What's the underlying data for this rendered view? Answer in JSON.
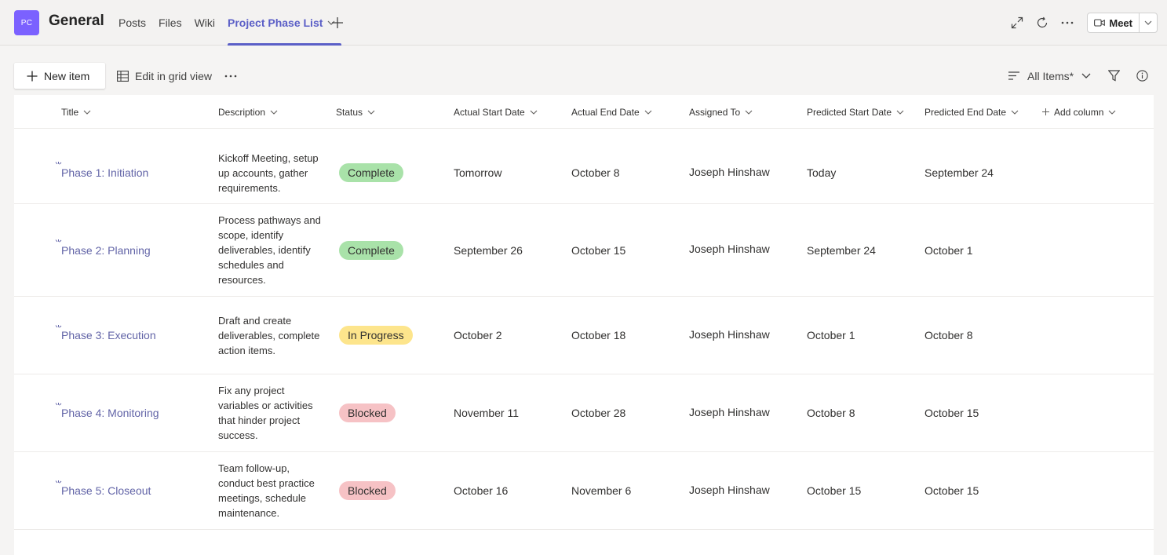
{
  "header": {
    "team_initials": "PC",
    "channel_name": "General",
    "tabs": [
      {
        "label": "Posts"
      },
      {
        "label": "Files"
      },
      {
        "label": "Wiki"
      },
      {
        "label": "Project Phase List"
      }
    ],
    "active_tab": 3,
    "meet_label": "Meet"
  },
  "toolbar": {
    "new_item_label": "New item",
    "grid_view_label": "Edit in grid view",
    "view_label": "All Items*"
  },
  "columns": [
    {
      "label": "Title"
    },
    {
      "label": "Description"
    },
    {
      "label": "Status"
    },
    {
      "label": "Actual Start Date"
    },
    {
      "label": "Actual End Date"
    },
    {
      "label": "Assigned To"
    },
    {
      "label": "Predicted Start Date"
    },
    {
      "label": "Predicted End Date"
    },
    {
      "label": "Add column"
    }
  ],
  "status_colors": {
    "Complete": "#a9e2a9",
    "In Progress": "#fde58c",
    "Blocked": "#f6c2c5"
  },
  "brand_color": "#5b5fc7",
  "rows": [
    {
      "title": "Phase 1: Initiation",
      "description": "Kickoff Meeting, setup up accounts, gather requirements.",
      "status": "Complete",
      "actual_start": "Tomorrow",
      "actual_end": "October 8",
      "assigned_to": "Joseph Hinshaw",
      "predicted_start": "Today",
      "predicted_end": "September 24"
    },
    {
      "title": "Phase 2: Planning",
      "description": "Process pathways and scope, identify deliverables, identify schedules and resources.",
      "status": "Complete",
      "actual_start": "September 26",
      "actual_end": "October 15",
      "assigned_to": "Joseph Hinshaw",
      "predicted_start": "September 24",
      "predicted_end": "October 1"
    },
    {
      "title": "Phase 3: Execution",
      "description": "Draft and create deliverables, complete action items.",
      "status": "In Progress",
      "actual_start": "October 2",
      "actual_end": "October 18",
      "assigned_to": "Joseph Hinshaw",
      "predicted_start": "October 1",
      "predicted_end": "October 8"
    },
    {
      "title": "Phase 4: Monitoring",
      "description": "Fix any project variables or activities that hinder project success.",
      "status": "Blocked",
      "actual_start": "November 11",
      "actual_end": "October 28",
      "assigned_to": "Joseph Hinshaw",
      "predicted_start": "October 8",
      "predicted_end": "October 15"
    },
    {
      "title": "Phase 5: Closeout",
      "description": "Team follow-up, conduct best practice meetings, schedule maintenance.",
      "status": "Blocked",
      "actual_start": "October 16",
      "actual_end": "November 6",
      "assigned_to": "Joseph Hinshaw",
      "predicted_start": "October 15",
      "predicted_end": "October 15"
    }
  ]
}
